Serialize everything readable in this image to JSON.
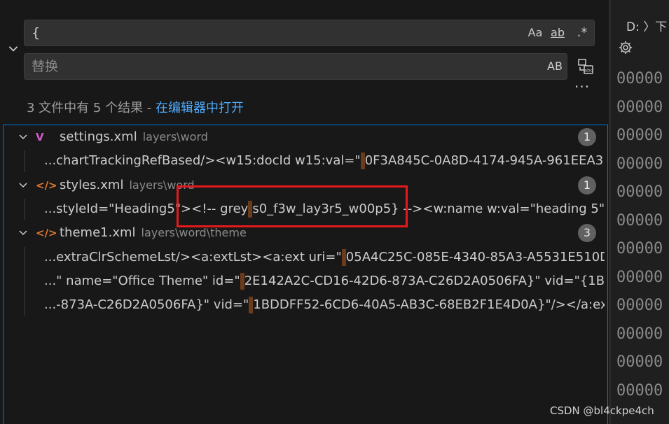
{
  "search": {
    "find_value": "{",
    "opt_match_case": "Aa",
    "opt_whole_word": "ab",
    "opt_regex": ".*",
    "replace_placeholder": "替换",
    "opt_preserve_case": "AB",
    "more": "···"
  },
  "summary": {
    "text": "3 文件中有 5 个结果 - ",
    "link": "在编辑器中打开"
  },
  "results": [
    {
      "icon": "V",
      "icon_color": "#d35bcc",
      "name": "settings.xml",
      "path": "layers\\word",
      "count": "1",
      "matches": [
        {
          "before": "...chartTrackingRefBased/><w15:docId w15:val=\"",
          "after": "0F3A845C-0A8D-4174-945A-961EEA3..."
        }
      ]
    },
    {
      "icon": "</>",
      "icon_color": "#e37933",
      "name": "styles.xml",
      "path": "layers\\word",
      "count": "1",
      "matches": [
        {
          "before": "...styleId=\"Heading5\"><!-- grey",
          "after": "s0_f3w_lay3r5_w00p5} --><w:name w:val=\"heading 5\"/..."
        }
      ]
    },
    {
      "icon": "</>",
      "icon_color": "#e37933",
      "name": "theme1.xml",
      "path": "layers\\word\\theme",
      "count": "3",
      "matches": [
        {
          "before": "...extraClrSchemeLst/><a:extLst><a:ext uri=\"",
          "after": "05A4C25C-085E-4340-85A3-A5531E510D..."
        },
        {
          "before": "...\" name=\"Office Theme\" id=\"",
          "after": "2E142A2C-CD16-42D6-873A-C26D2A0506FA}\" vid=\"{1B..."
        },
        {
          "before": "...-873A-C26D2A0506FA}\" vid=\"",
          "after": "1BDDFF52-6CD6-40A5-AB3C-68EB2F1E4D0A}\"/></a:ex..."
        }
      ]
    }
  ],
  "editor": {
    "breadcrumb": "D: 〉下",
    "line_text": "00000",
    "line_count": 12
  },
  "watermark": "CSDN @bl4ckpe4ch",
  "colors": {
    "accent": "#0078d4",
    "link": "#4daafc",
    "match_highlight": "#6b3c1c",
    "annotation_box": "#e3191e"
  }
}
